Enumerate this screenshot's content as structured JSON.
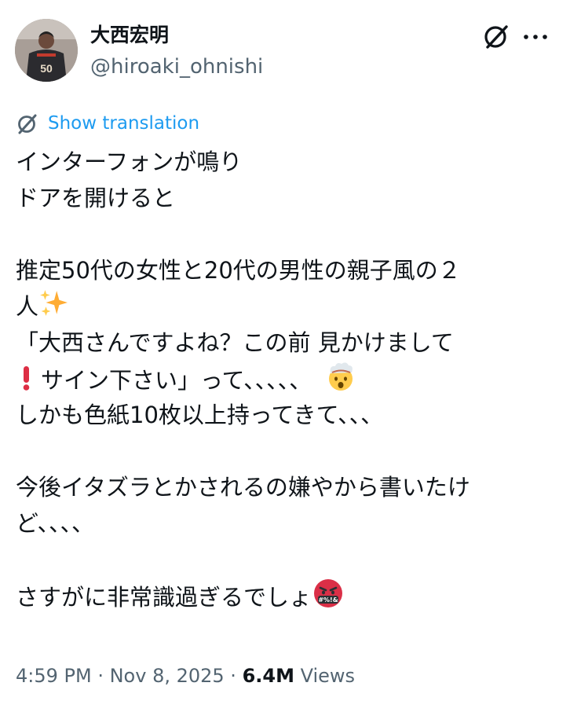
{
  "author": {
    "display_name": "大西宏明",
    "handle": "@hiroaki_ohnishi",
    "avatar_jersey_number": "50"
  },
  "translate": {
    "label": "Show translation"
  },
  "body": {
    "l1": "インターフォンが鳴り",
    "l2": "ドアを開けると",
    "l3": "推定50代の女性と20代の男性の親子風の２",
    "l4": "人",
    "l5": "「大西さんですよね？この前 見かけまして",
    "l6": "サイン下さい」って、、、、、",
    "l7": "しかも色紙10枚以上持ってきて、、、",
    "l8": "今後イタズラとかされるの嫌やから書いたけ",
    "l9": "ど、、、、",
    "l10": "さすがに非常識過ぎるでしょ",
    "emoji_cursing_text": "#%!&"
  },
  "meta": {
    "time": "4:59 PM",
    "separator": " · ",
    "date": "Nov 8, 2025",
    "views_count": "6.4M",
    "views_label": " Views"
  },
  "icons": {
    "grok": "grok-icon",
    "more": "more-icon",
    "translate": "translate-icon",
    "sparkles": "sparkles-emoji",
    "exclamation": "red-exclamation-emoji",
    "exploding_head": "exploding-head-emoji",
    "cursing_face": "cursing-face-emoji"
  },
  "colors": {
    "text": "#0f1419",
    "secondary": "#536471",
    "link": "#1d9bf0",
    "emoji_red": "#dd2e44",
    "emoji_gold": "#ffac33"
  }
}
